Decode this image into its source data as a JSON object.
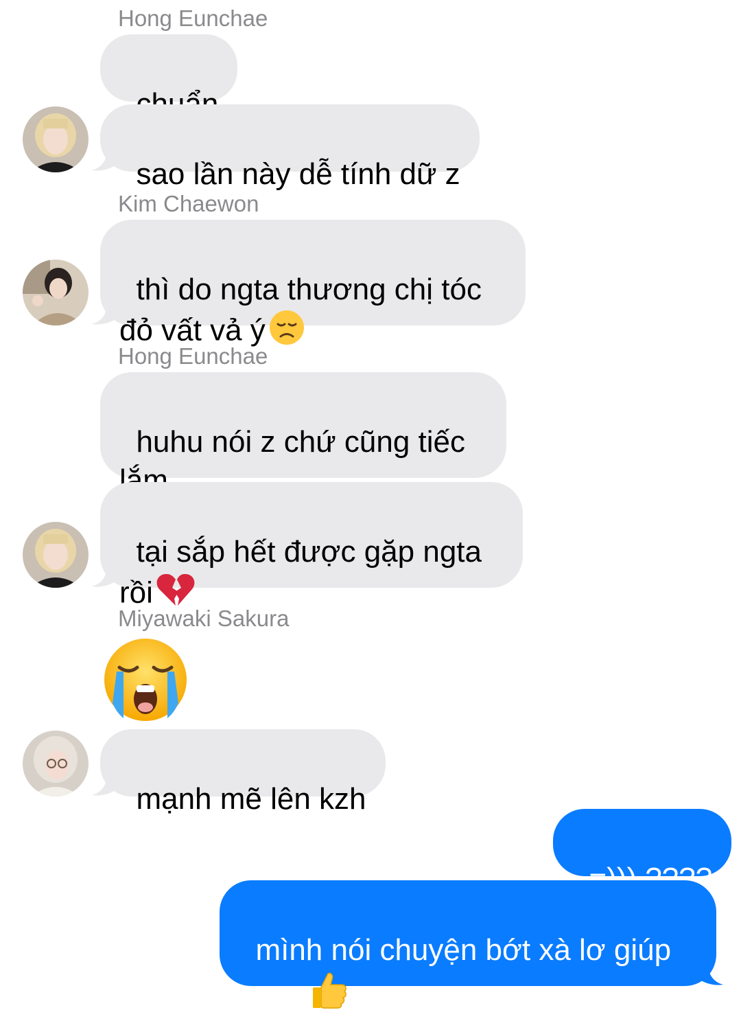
{
  "conversation": {
    "messages": [
      {
        "sender": "Hong Eunchae",
        "text": "chuẩn"
      },
      {
        "text": "sao lần này dễ tính dữ z"
      },
      {
        "sender": "Kim Chaewon",
        "text": "thì do ngta thương chị tóc\nđỏ vất vả ý"
      },
      {
        "sender": "Hong Eunchae",
        "text": "huhu nói z chứ cũng tiếc\nlắm"
      },
      {
        "text": "tại sắp hết được gặp ngta\nrồi"
      },
      {
        "sender": "Miyawaki Sakura",
        "emoji": "loudly-crying-face"
      },
      {
        "text": "mạnh mẽ lên kzh"
      },
      {
        "text": "=))) ????"
      },
      {
        "text": "mình nói chuyện bớt xà lơ giúp\nem ạ"
      }
    ]
  },
  "icons": {
    "disappointed": "disappointed-face-emoji",
    "broken_heart": "broken-heart-emoji",
    "crying": "loudly-crying-face-emoji",
    "thumbs_up": "thumbs-up-emoji"
  },
  "colors": {
    "incoming_bubble": "#e9e9eb",
    "outgoing_bubble": "#0a7cff",
    "sender_name": "#8a8a8e"
  }
}
